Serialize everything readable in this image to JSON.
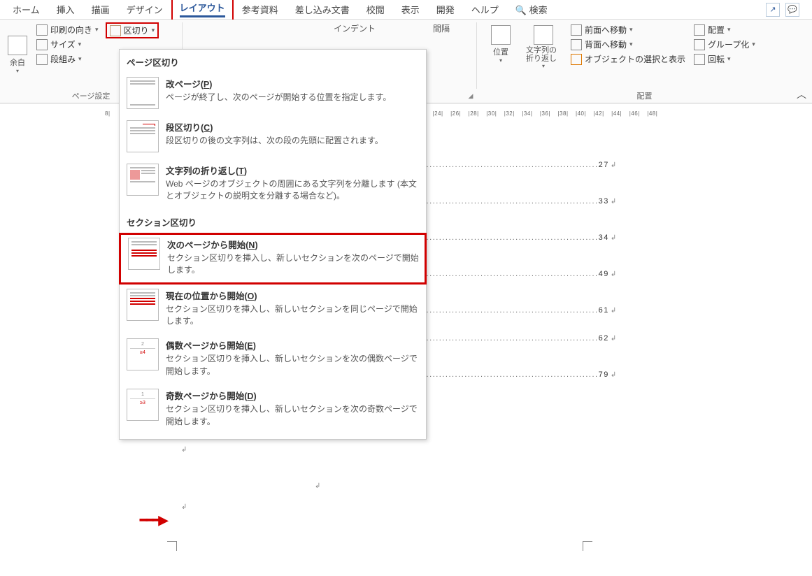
{
  "tabs": {
    "home": "ホーム",
    "insert": "挿入",
    "draw": "描画",
    "design": "デザイン",
    "layout": "レイアウト",
    "references": "参考資料",
    "mailings": "差し込み文書",
    "review": "校閲",
    "view": "表示",
    "developer": "開発",
    "help": "ヘルプ",
    "search_icon": "🔍",
    "search": "検索"
  },
  "ribbon": {
    "margins": "余白",
    "orientation": "印刷の向き",
    "size": "サイズ",
    "columns": "段組み",
    "breaks": "区切り",
    "indent_header": "インデント",
    "spacing_header": "間隔",
    "page_setup_label": "ページ設定",
    "arrange_label": "配置",
    "position": "位置",
    "wrap_text": "文字列の折り返し",
    "bring_forward": "前面へ移動",
    "send_backward": "背面へ移動",
    "selection_pane": "オブジェクトの選択と表示",
    "align": "配置",
    "group": "グループ化",
    "rotate": "回転"
  },
  "dropdown": {
    "header1": "ページ区切り",
    "page_break_title": "改ページ(",
    "page_break_key": "P",
    "page_break_title_end": ")",
    "page_break_desc": "ページが終了し、次のページが開始する位置を指定します。",
    "column_break_title": "段区切り(",
    "column_break_key": "C",
    "column_break_title_end": ")",
    "column_break_desc": "段区切りの後の文字列は、次の段の先頭に配置されます。",
    "text_wrap_title": "文字列の折り返し(",
    "text_wrap_key": "T",
    "text_wrap_title_end": ")",
    "text_wrap_desc": "Web ページのオブジェクトの周囲にある文字列を分離します (本文とオブジェクトの説明文を分離する場合など)。",
    "header2": "セクション区切り",
    "next_page_title": "次のページから開始(",
    "next_page_key": "N",
    "next_page_title_end": ")",
    "next_page_desc": "セクション区切りを挿入し、新しいセクションを次のページで開始します。",
    "continuous_title": "現在の位置から開始(",
    "continuous_key": "O",
    "continuous_title_end": ")",
    "continuous_desc": "セクション区切りを挿入し、新しいセクションを同じページで開始します。",
    "even_page_title": "偶数ページから開始(",
    "even_page_key": "E",
    "even_page_title_end": ")",
    "even_page_desc": "セクション区切りを挿入し、新しいセクションを次の偶数ページで開始します。",
    "odd_page_title": "奇数ページから開始(",
    "odd_page_key": "D",
    "odd_page_title_end": ")",
    "odd_page_desc": "セクション区切りを挿入し、新しいセクションを次の奇数ページで開始します。"
  },
  "ruler_marks": [
    "8",
    "|",
    "",
    "",
    "|24|",
    "|26|",
    "|28|",
    "|30|",
    "|32|",
    "|34|",
    "|36|",
    "|38|",
    "|40|",
    "|42|",
    "|44|",
    "|46|",
    "|48|"
  ],
  "document": {
    "rows": [
      {
        "pnum": "27"
      },
      {
        "pnum": "33"
      },
      {
        "pnum": "34"
      },
      {
        "pnum": "49"
      },
      {
        "pnum": "61"
      },
      {
        "pnum": "62"
      },
      {
        "pnum": "79"
      }
    ]
  }
}
